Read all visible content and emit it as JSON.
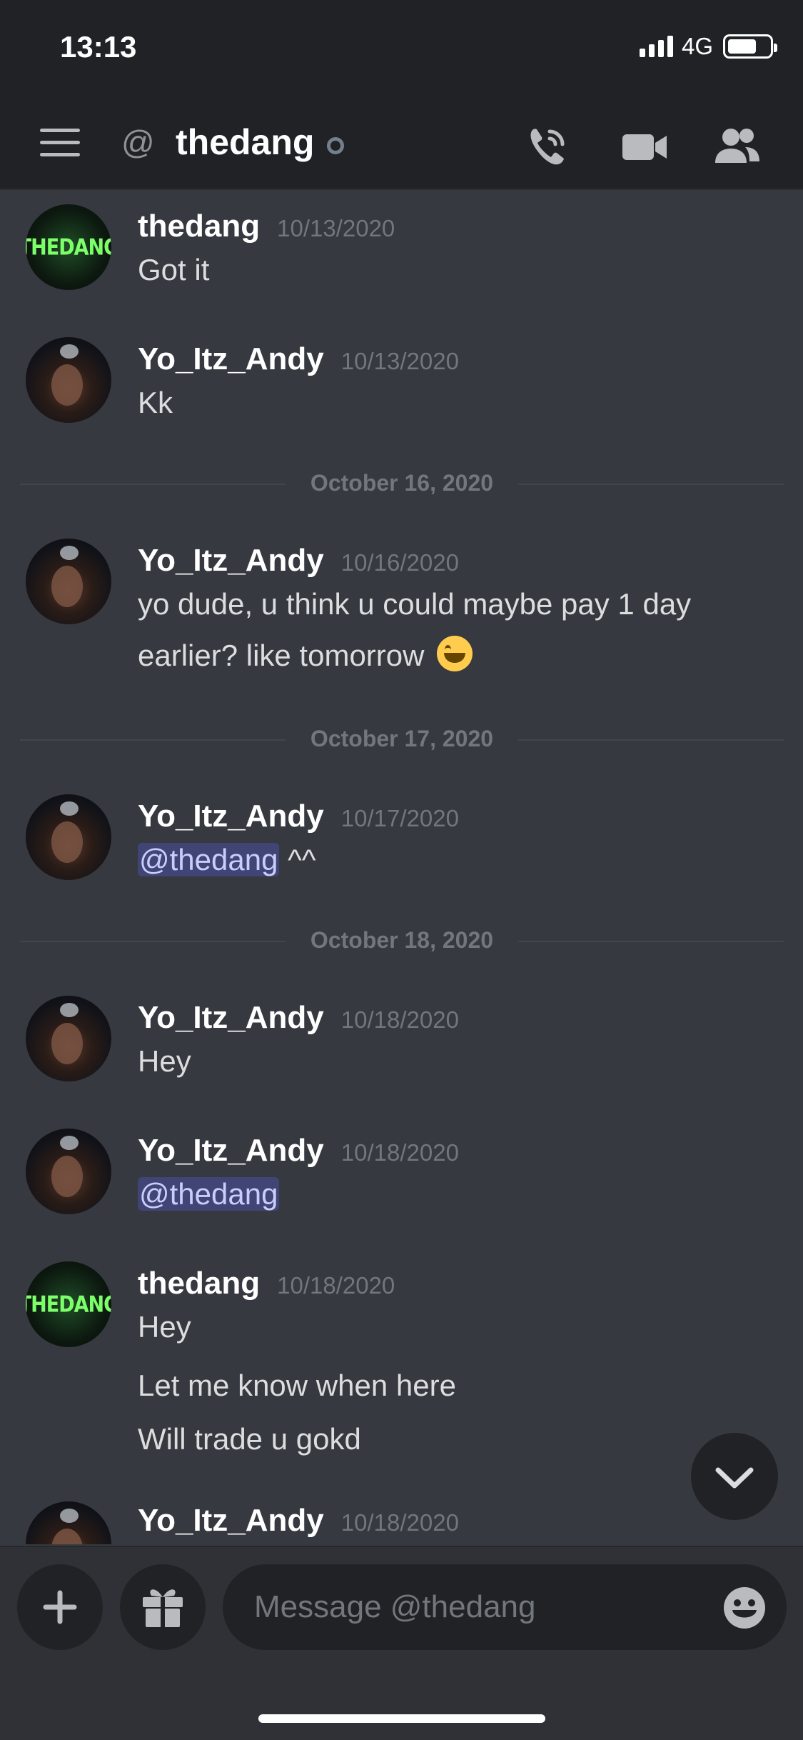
{
  "status_bar": {
    "time": "13:13",
    "network": "4G",
    "battery_level": 0.7
  },
  "header": {
    "channel_prefix_icon": "at-icon",
    "channel_name": "thedang",
    "icons": [
      "menu-icon",
      "call-icon",
      "video-icon",
      "members-icon"
    ]
  },
  "messages": [
    {
      "author": "thedang",
      "timestamp": "10/13/2020",
      "lines": [
        "Got it"
      ]
    },
    {
      "author": "Yo_Itz_Andy",
      "timestamp": "10/13/2020",
      "lines": [
        "Kk"
      ]
    },
    {
      "divider": "October 16, 2020"
    },
    {
      "author": "Yo_Itz_Andy",
      "timestamp": "10/16/2020",
      "lines": [
        "yo dude, u think u could maybe pay 1 day",
        "earlier? like tomorrow"
      ]
    },
    {
      "divider": "October 17, 2020"
    },
    {
      "author": "Yo_Itz_Andy",
      "timestamp": "10/17/2020",
      "mention": "@thedang",
      "suffix": " ^^"
    },
    {
      "divider": "October 18, 2020"
    },
    {
      "author": "Yo_Itz_Andy",
      "timestamp": "10/18/2020",
      "lines": [
        "Hey"
      ]
    },
    {
      "author": "Yo_Itz_Andy",
      "timestamp": "10/18/2020",
      "mention": "@thedang"
    },
    {
      "author": "thedang",
      "timestamp": "10/18/2020",
      "lines": [
        "Hey",
        "Let me know when here",
        "Will trade u gokd"
      ]
    },
    {
      "author": "Yo_Itz_Andy",
      "timestamp": "10/18/2020"
    }
  ],
  "avatar_labels": {
    "thedang": "THEDANG"
  },
  "composer": {
    "placeholder": "Message @thedang"
  },
  "colors": {
    "background": "#36393f",
    "header": "#202225",
    "mention_bg": "#414675",
    "mention_text": "#c9cdfb",
    "timestamp": "#72767d"
  }
}
